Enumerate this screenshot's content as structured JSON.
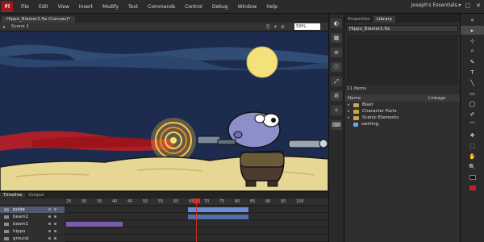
{
  "menubar": {
    "logo": "Fl",
    "items": [
      "File",
      "Edit",
      "View",
      "Insert",
      "Modify",
      "Text",
      "Commands",
      "Control",
      "Debug",
      "Window",
      "Help"
    ],
    "workspace": "Joseph's Essentials ▾",
    "window_controls": [
      "–",
      "▢",
      "✕"
    ]
  },
  "document": {
    "tab_title": "Hippo_Blaster2.fla (Canvas)*",
    "scene_label": "Scene 1",
    "zoom": "59%"
  },
  "library": {
    "tabs": [
      "Properties",
      "Library"
    ],
    "file_select": "Hippo_Blaster2.fla",
    "item_count": "11 items",
    "columns": [
      "Name",
      "Linkage"
    ],
    "items": [
      {
        "label": "Blast",
        "type": "folder"
      },
      {
        "label": "Character Parts",
        "type": "folder"
      },
      {
        "label": "Scenic Elements",
        "type": "folder"
      },
      {
        "label": "swirling",
        "type": "symbol"
      }
    ]
  },
  "timeline": {
    "tabs": [
      "Timeline",
      "Output"
    ],
    "ruler": [
      "25",
      "30",
      "35",
      "40",
      "45",
      "50",
      "55",
      "60",
      "65",
      "70",
      "75",
      "80",
      "85",
      "90",
      "95",
      "100"
    ],
    "layers": [
      {
        "name": "pulse",
        "active": true
      },
      {
        "name": "beam2",
        "active": false
      },
      {
        "name": "beam1",
        "active": false
      },
      {
        "name": "hippo",
        "active": false
      },
      {
        "name": "ground",
        "active": false
      }
    ]
  },
  "tools": [
    "▸",
    "⊹",
    "⌕",
    "✎",
    "T",
    "╲",
    "▭",
    "◯",
    "✐",
    "⌒",
    "❖",
    "⬚",
    "✋",
    "🔍"
  ],
  "colors": {
    "stage_sky": "#1d2c4e",
    "moon": "#f3e27a",
    "ground": "#e6d795",
    "hippo": "#8d8fcb",
    "blast_red": "#c41d24",
    "playhead": "#d0302b",
    "fill_swatch": "#c41d24"
  }
}
